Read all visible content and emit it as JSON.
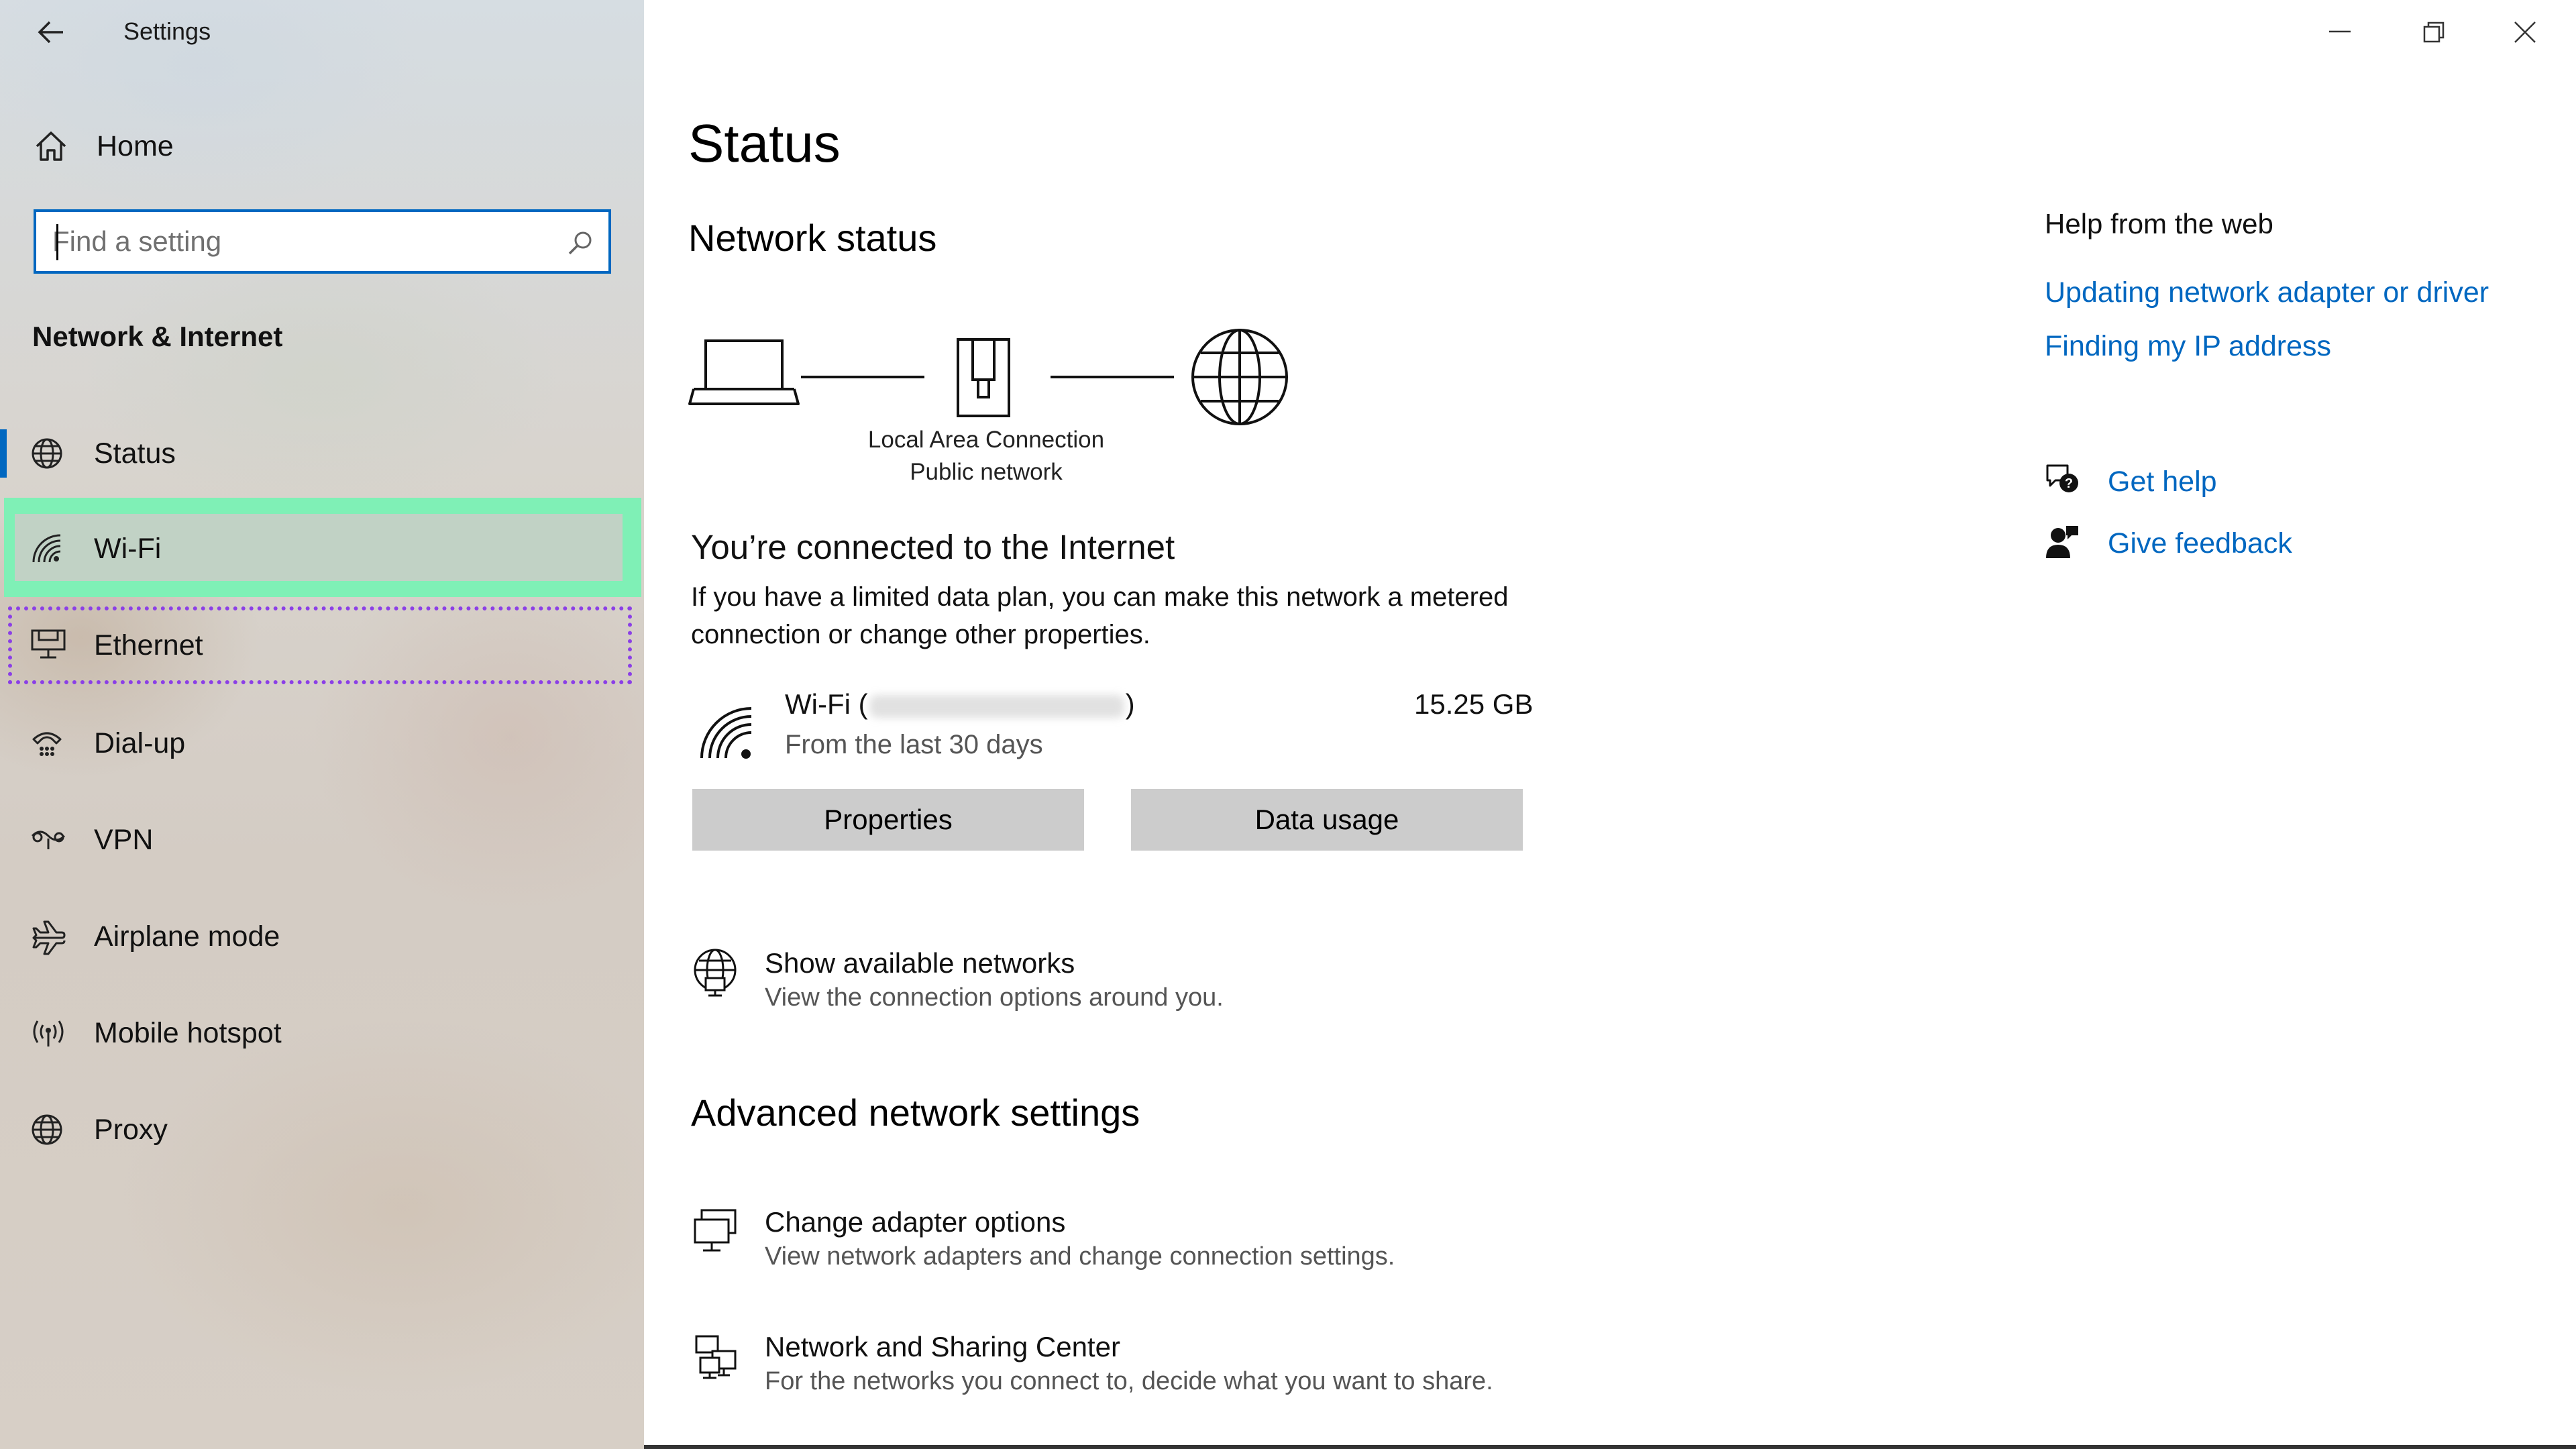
{
  "window": {
    "title": "Settings",
    "controls": {
      "minimize": "minimize",
      "maximize": "maximize",
      "close": "close"
    }
  },
  "sidebar": {
    "home_label": "Home",
    "search": {
      "placeholder": "Find a setting",
      "value": ""
    },
    "section_title": "Network & Internet",
    "items": [
      {
        "id": "status",
        "label": "Status",
        "icon": "globe-status-icon",
        "active": true
      },
      {
        "id": "wifi",
        "label": "Wi-Fi",
        "icon": "wifi-icon",
        "highlighted": true
      },
      {
        "id": "ethernet",
        "label": "Ethernet",
        "icon": "ethernet-icon",
        "hovered": true
      },
      {
        "id": "dialup",
        "label": "Dial-up",
        "icon": "dialup-icon"
      },
      {
        "id": "vpn",
        "label": "VPN",
        "icon": "vpn-icon"
      },
      {
        "id": "airplane",
        "label": "Airplane mode",
        "icon": "airplane-icon"
      },
      {
        "id": "hotspot",
        "label": "Mobile hotspot",
        "icon": "hotspot-icon"
      },
      {
        "id": "proxy",
        "label": "Proxy",
        "icon": "globe-icon"
      }
    ]
  },
  "main": {
    "title": "Status",
    "network_status_heading": "Network status",
    "diagram": {
      "caption_line1": "Local Area Connection",
      "caption_line2": "Public network"
    },
    "connected_heading": "You’re connected to the Internet",
    "connected_desc": "If you have a limited data plan, you can make this network a metered connection or change other properties.",
    "wifi": {
      "name_prefix": "Wi-Fi (",
      "name_suffix": ")",
      "subtitle": "From the last 30 days",
      "usage": "15.25 GB"
    },
    "buttons": {
      "properties": "Properties",
      "data_usage": "Data usage"
    },
    "show_networks": {
      "title": "Show available networks",
      "desc": "View the connection options around you."
    },
    "advanced_heading": "Advanced network settings",
    "adapter_options": {
      "title": "Change adapter options",
      "desc": "View network adapters and change connection settings."
    },
    "sharing_center": {
      "title": "Network and Sharing Center",
      "desc": "For the networks you connect to, decide what you want to share."
    }
  },
  "help": {
    "heading": "Help from the web",
    "links": [
      "Updating network adapter or driver",
      "Finding my IP address"
    ],
    "get_help": "Get help",
    "give_feedback": "Give feedback"
  },
  "colors": {
    "accent": "#0067c0",
    "wifi_highlight": "#7ff0b6",
    "ethernet_outline": "#8b3fe6",
    "button_bg": "#cccccc"
  }
}
